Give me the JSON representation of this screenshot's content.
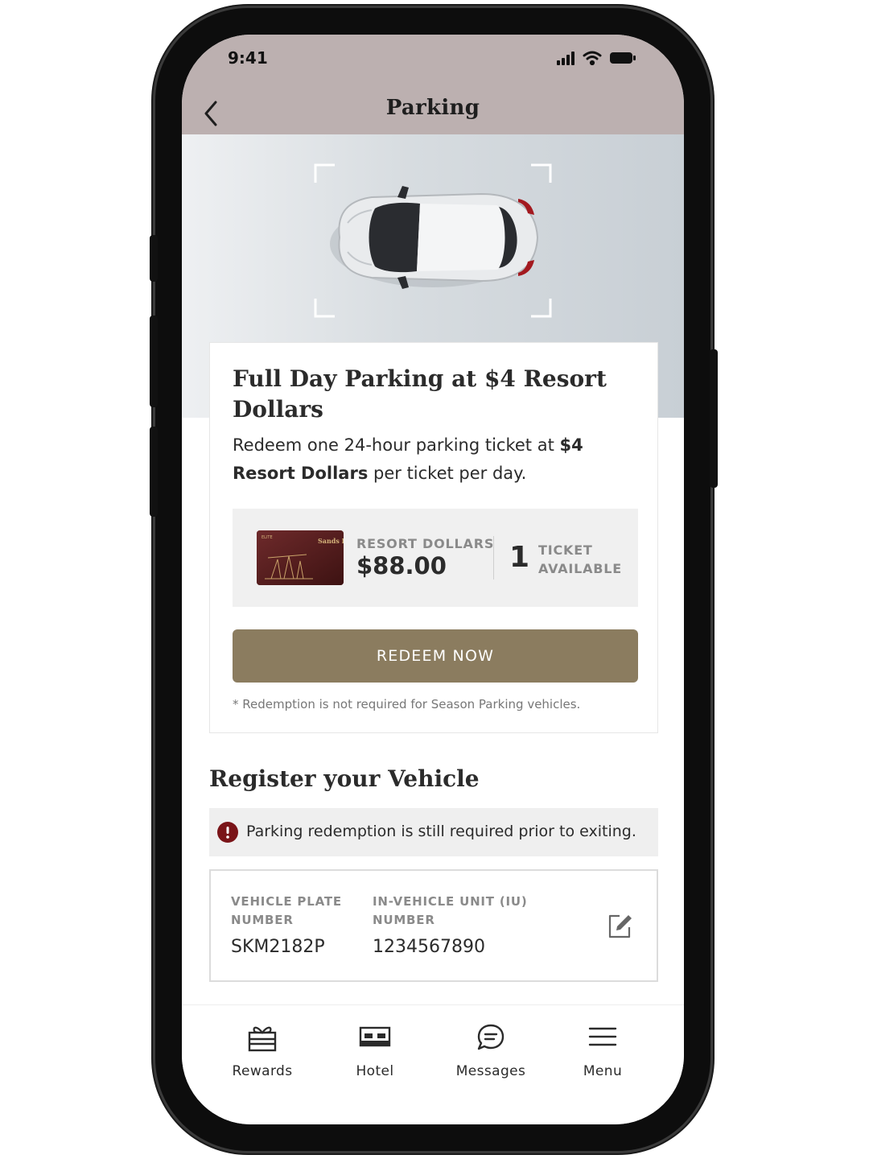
{
  "status_bar": {
    "time": "9:41"
  },
  "header": {
    "title": "Parking"
  },
  "offer": {
    "title": "Full Day Parking at $4 Resort Dollars",
    "desc_part1": "Redeem one 24-hour parking ticket at ",
    "desc_bold1": "$4",
    "desc_bold2": "Resort Dollars",
    "desc_part2": " per ticket per day.",
    "card_brand": "Sands LIFESTYLE",
    "card_tier": "ELITE",
    "balance_label": "RESORT DOLLARS",
    "balance_value": "$88.00",
    "ticket_count": "1",
    "ticket_label": "TICKET AVAILABLE",
    "redeem_button": "REDEEM NOW",
    "note": "* Redemption is not required for Season Parking vehicles."
  },
  "register": {
    "title": "Register your Vehicle",
    "alert": "Parking redemption is still required prior to exiting.",
    "plate_label": "VEHICLE PLATE NUMBER",
    "plate_value": "SKM2182P",
    "iu_label": "IN-VEHICLE UNIT (IU) NUMBER",
    "iu_value": "1234567890"
  },
  "nav": {
    "items": [
      {
        "label": "Rewards",
        "icon": "gift-icon"
      },
      {
        "label": "Hotel",
        "icon": "bed-icon"
      },
      {
        "label": "Messages",
        "icon": "chat-icon"
      },
      {
        "label": "Menu",
        "icon": "menu-icon"
      }
    ]
  },
  "colors": {
    "header_bg": "#bcb0b0",
    "accent": "#8b7c5f",
    "alert": "#7a1418",
    "card_maroon": "#5a1f20"
  }
}
